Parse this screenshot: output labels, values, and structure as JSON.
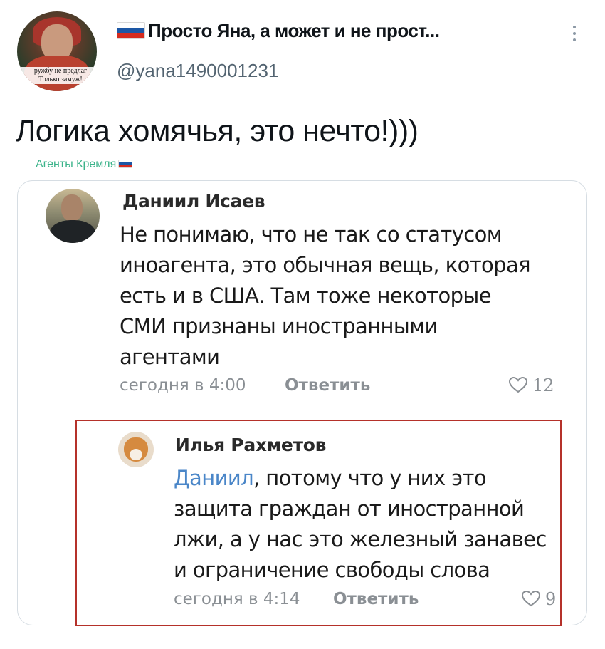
{
  "header": {
    "display_name": "Просто Яна, а может и не прост...",
    "handle": "@yana1490001231",
    "avatar_caption_line1": "ружбу не предлаг",
    "avatar_caption_line2": "Только замуж!"
  },
  "tweet": {
    "text": "Логика хомячья, это нечто!)))",
    "source_label": "Агенты Кремля"
  },
  "comments": [
    {
      "author": "Даниил Исаев",
      "lines": [
        "Не понимаю, что не так со статусом",
        "иноагента, это обычная вещь, которая",
        "есть и в США. Там тоже некоторые",
        "СМИ признаны иностранными",
        "агентами"
      ],
      "time": "сегодня в 4:00",
      "reply_label": "Ответить",
      "likes": "12"
    },
    {
      "author": "Илья Рахметов",
      "mention": "Даниил",
      "first_line_rest": ", потому что у них это",
      "lines": [
        "защита граждан от иностранной",
        "лжи, а у нас это железный занавес",
        "и ограничение свободы слова"
      ],
      "time": "сегодня в 4:14",
      "reply_label": "Ответить",
      "likes": "9"
    }
  ],
  "icons": {
    "more": "more-vertical-icon",
    "flag": "russian-flag-icon",
    "heart": "heart-outline-icon"
  },
  "colors": {
    "handle": "#536471",
    "source_tag": "#3bb38a",
    "mention": "#4a86c8",
    "highlight_border": "#b5312a"
  }
}
